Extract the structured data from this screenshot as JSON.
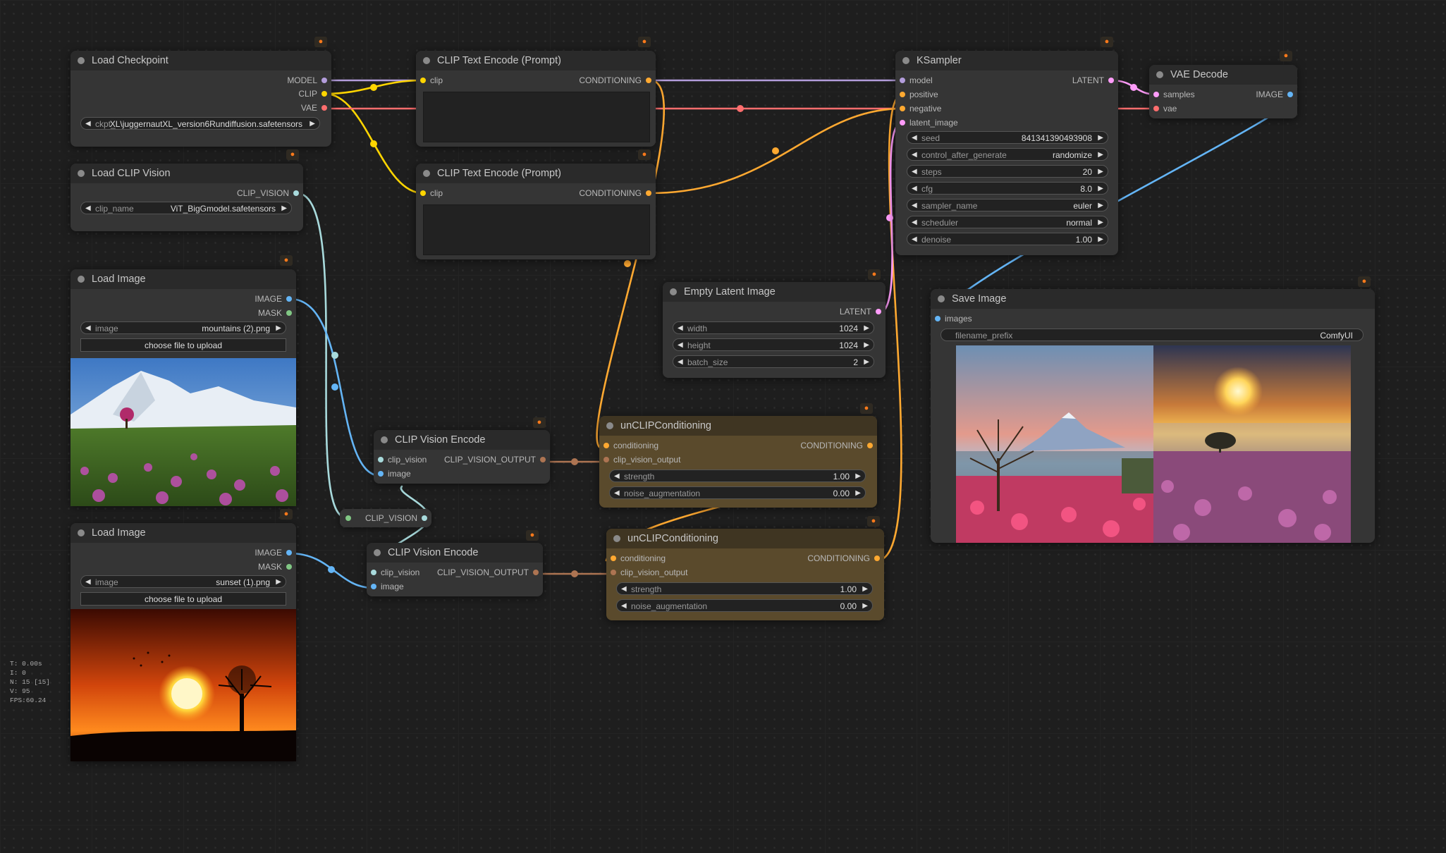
{
  "colors": {
    "model": "#b39ddb",
    "clip": "#ffd500",
    "vae": "#ff6e6e",
    "conditioning": "#ffa931",
    "clip_vision": "#a8dadc",
    "image": "#64b5f6",
    "latent": "#ff9cf9",
    "mask": "#81c784",
    "clip_vision_output": "#ad7452"
  },
  "stats": {
    "t": "T: 0.00s",
    "i": "I: 0",
    "n": "N: 15 [15]",
    "v": "V: 95",
    "fps": "FPS:60.24"
  },
  "badge_icon": "fox-icon",
  "nodes": {
    "load_checkpoint": {
      "title": "Load Checkpoint",
      "outputs": [
        "MODEL",
        "CLIP",
        "VAE"
      ],
      "ckpt_label": "ckpt_",
      "ckpt_value": "XL\\juggernautXL_version6Rundiffusion.safetensors"
    },
    "load_clip_vision": {
      "title": "Load CLIP Vision",
      "output": "CLIP_VISION",
      "clip_name_label": "clip_name",
      "clip_name_value": "ViT_BigGmodel.safetensors"
    },
    "load_image_1": {
      "title": "Load Image",
      "outputs": [
        "IMAGE",
        "MASK"
      ],
      "image_label": "image",
      "image_value": "mountains (2).png",
      "upload": "choose file to upload"
    },
    "load_image_2": {
      "title": "Load Image",
      "outputs": [
        "IMAGE",
        "MASK"
      ],
      "image_label": "image",
      "image_value": "sunset (1).png",
      "upload": "choose file to upload"
    },
    "clip_text_1": {
      "title": "CLIP Text Encode (Prompt)",
      "input": "clip",
      "output": "CONDITIONING"
    },
    "clip_text_2": {
      "title": "CLIP Text Encode (Prompt)",
      "input": "clip",
      "output": "CONDITIONING"
    },
    "clip_vision_encode_1": {
      "title": "CLIP Vision Encode",
      "inputs": [
        "clip_vision",
        "image"
      ],
      "output": "CLIP_VISION_OUTPUT"
    },
    "clip_vision_encode_2": {
      "title": "CLIP Vision Encode",
      "inputs": [
        "clip_vision",
        "image"
      ],
      "output": "CLIP_VISION_OUTPUT"
    },
    "reroute": {
      "label": "CLIP_VISION"
    },
    "unclip_1": {
      "title": "unCLIPConditioning",
      "inputs": [
        "conditioning",
        "clip_vision_output"
      ],
      "output": "CONDITIONING",
      "strength_label": "strength",
      "strength": "1.00",
      "noise_label": "noise_augmentation",
      "noise": "0.00"
    },
    "unclip_2": {
      "title": "unCLIPConditioning",
      "inputs": [
        "conditioning",
        "clip_vision_output"
      ],
      "output": "CONDITIONING",
      "strength_label": "strength",
      "strength": "1.00",
      "noise_label": "noise_augmentation",
      "noise": "0.00"
    },
    "empty_latent": {
      "title": "Empty Latent Image",
      "output": "LATENT",
      "width_label": "width",
      "width": "1024",
      "height_label": "height",
      "height": "1024",
      "batch_label": "batch_size",
      "batch": "2"
    },
    "ksampler": {
      "title": "KSampler",
      "inputs": [
        "model",
        "positive",
        "negative",
        "latent_image"
      ],
      "output": "LATENT",
      "widgets": [
        {
          "label": "seed",
          "value": "841341390493908"
        },
        {
          "label": "control_after_generate",
          "value": "randomize"
        },
        {
          "label": "steps",
          "value": "20"
        },
        {
          "label": "cfg",
          "value": "8.0"
        },
        {
          "label": "sampler_name",
          "value": "euler"
        },
        {
          "label": "scheduler",
          "value": "normal"
        },
        {
          "label": "denoise",
          "value": "1.00"
        }
      ]
    },
    "vae_decode": {
      "title": "VAE Decode",
      "inputs": [
        "samples",
        "vae"
      ],
      "output": "IMAGE"
    },
    "save_image": {
      "title": "Save Image",
      "input": "images",
      "prefix_label": "filename_prefix",
      "prefix_value": "ComfyUI"
    }
  }
}
